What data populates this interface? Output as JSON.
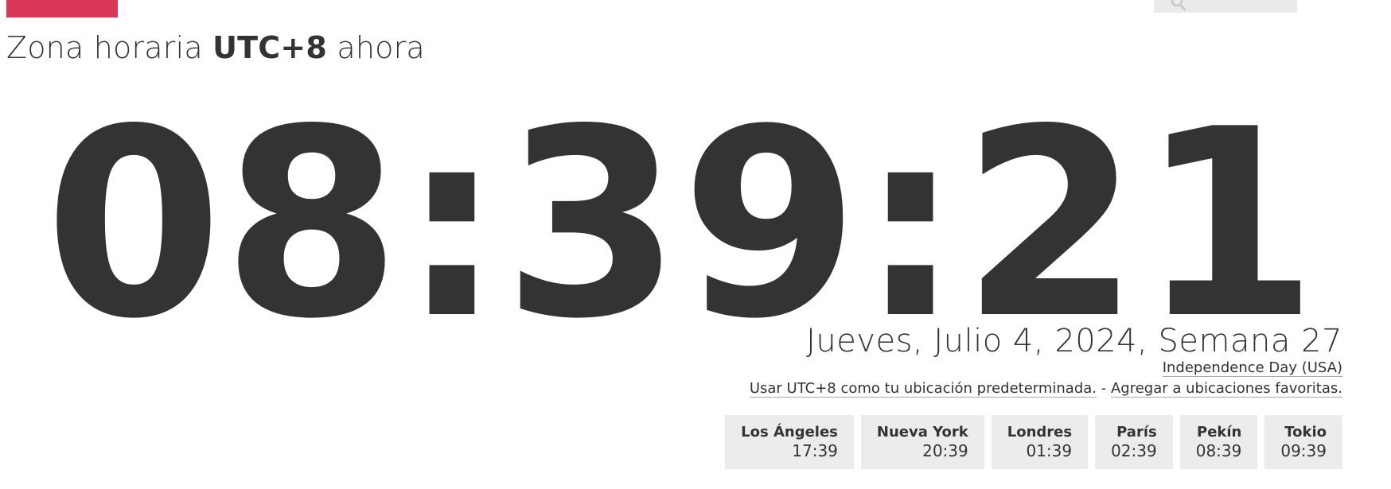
{
  "header": {
    "heading_prefix": "Zona horaria",
    "timezone": "UTC+8",
    "heading_suffix": "ahora"
  },
  "clock": {
    "time": "08:39:21"
  },
  "date": {
    "text": "Jueves, Julio 4, 2024, Semana 27"
  },
  "holiday": {
    "text": "Independence Day (USA)"
  },
  "links": {
    "set_default": "Usar UTC+8 como tu ubicación predeterminada.",
    "separator": " - ",
    "add_favorite": "Agregar a ubicaciones favoritas."
  },
  "cities": [
    {
      "name": "Los Ángeles",
      "time": "17:39"
    },
    {
      "name": "Nueva York",
      "time": "20:39"
    },
    {
      "name": "Londres",
      "time": "01:39"
    },
    {
      "name": "París",
      "time": "02:39"
    },
    {
      "name": "Pekín",
      "time": "08:39"
    },
    {
      "name": "Tokio",
      "time": "09:39"
    }
  ],
  "colors": {
    "accent": "#da3656",
    "text": "#333333",
    "city_bg": "#ececec"
  },
  "icons": {
    "search": "search-icon"
  }
}
